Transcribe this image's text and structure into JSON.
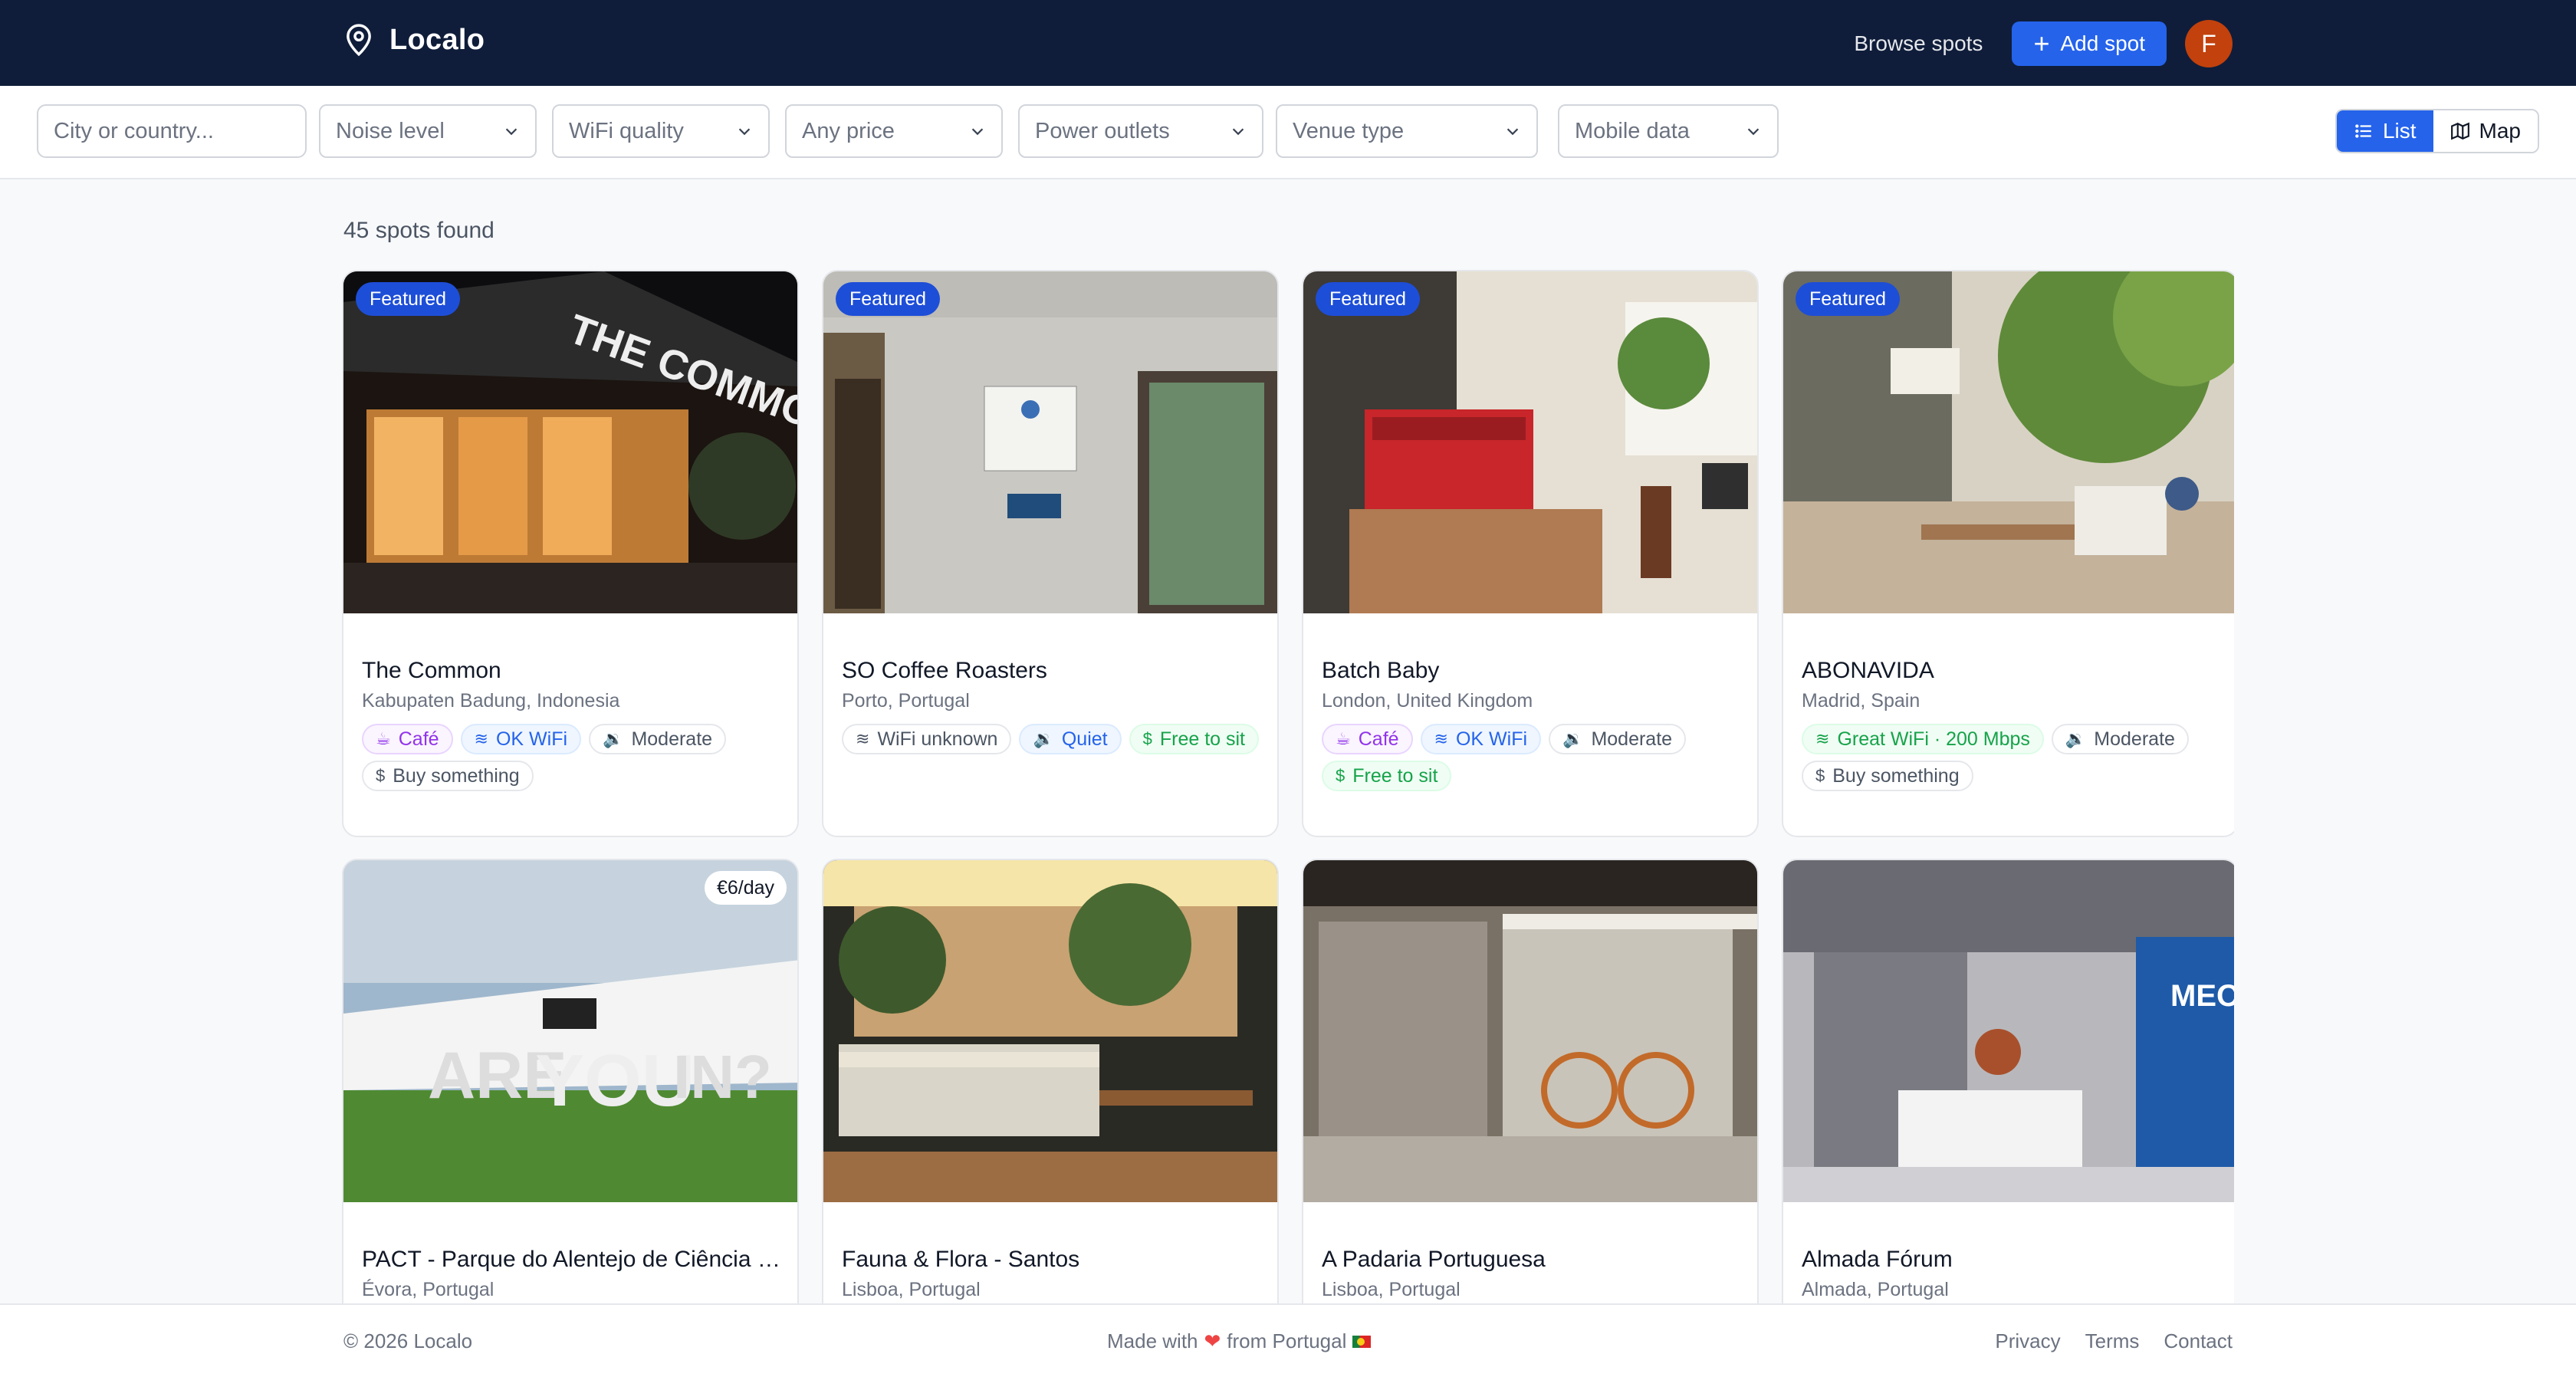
{
  "app": {
    "name": "Localo"
  },
  "nav": {
    "browse_label": "Browse spots",
    "add_label": "Add spot",
    "avatar_initial": "F"
  },
  "filters": {
    "search_placeholder": "City or country...",
    "selects": [
      {
        "label": "Noise level"
      },
      {
        "label": "WiFi quality"
      },
      {
        "label": "Any price"
      },
      {
        "label": "Power outlets"
      },
      {
        "label": "Venue type"
      },
      {
        "label": "Mobile data"
      }
    ],
    "view": {
      "list_label": "List",
      "map_label": "Map",
      "active": "list"
    }
  },
  "results": {
    "count_text": "45 spots found"
  },
  "spots": [
    {
      "title": "The Common",
      "location": "Kabupaten Badung, Indonesia",
      "badge": "Featured",
      "tags": [
        {
          "icon": "cup-icon",
          "text": "Café",
          "tone": "purple"
        },
        {
          "icon": "wifi-icon",
          "text": "OK WiFi",
          "tone": "blue"
        },
        {
          "icon": "speaker-icon",
          "text": "Moderate",
          "tone": "grey"
        },
        {
          "icon": "dollar-icon",
          "text": "Buy something",
          "tone": "grey"
        }
      ]
    },
    {
      "title": "SO Coffee Roasters",
      "location": "Porto, Portugal",
      "badge": "Featured",
      "tags": [
        {
          "icon": "wifi-icon",
          "text": "WiFi unknown",
          "tone": "grey"
        },
        {
          "icon": "speaker-icon",
          "text": "Quiet",
          "tone": "blue"
        },
        {
          "icon": "dollar-icon",
          "text": "Free to sit",
          "tone": "green"
        }
      ]
    },
    {
      "title": "Batch Baby",
      "location": "London, United Kingdom",
      "badge": "Featured",
      "tags": [
        {
          "icon": "cup-icon",
          "text": "Café",
          "tone": "purple"
        },
        {
          "icon": "wifi-icon",
          "text": "OK WiFi",
          "tone": "blue"
        },
        {
          "icon": "speaker-icon",
          "text": "Moderate",
          "tone": "grey"
        },
        {
          "icon": "dollar-icon",
          "text": "Free to sit",
          "tone": "green"
        }
      ]
    },
    {
      "title": "ABONAVIDA",
      "location": "Madrid, Spain",
      "badge": "Featured",
      "tags": [
        {
          "icon": "wifi-icon",
          "text": "Great WiFi · 200 Mbps",
          "tone": "green"
        },
        {
          "icon": "speaker-icon",
          "text": "Moderate",
          "tone": "grey"
        },
        {
          "icon": "dollar-icon",
          "text": "Buy something",
          "tone": "grey"
        }
      ]
    },
    {
      "title": "PACT - Parque do Alentejo de Ciência e…",
      "location": "Évora, Portugal",
      "price": "€6/day",
      "tags": []
    },
    {
      "title": "Fauna & Flora - Santos",
      "location": "Lisboa, Portugal",
      "tags": []
    },
    {
      "title": "A Padaria Portuguesa",
      "location": "Lisboa, Portugal",
      "tags": []
    },
    {
      "title": "Almada Fórum",
      "location": "Almada, Portugal",
      "tags": []
    }
  ],
  "footer": {
    "copyright": "© 2026 Localo",
    "made_prefix": "Made with",
    "made_suffix": "from Portugal",
    "links": [
      "Privacy",
      "Terms",
      "Contact"
    ]
  },
  "colors": {
    "nav_bg": "#0f1d3a",
    "accent": "#2563eb",
    "featured": "#1d4ed8",
    "avatar": "#c2410c"
  }
}
